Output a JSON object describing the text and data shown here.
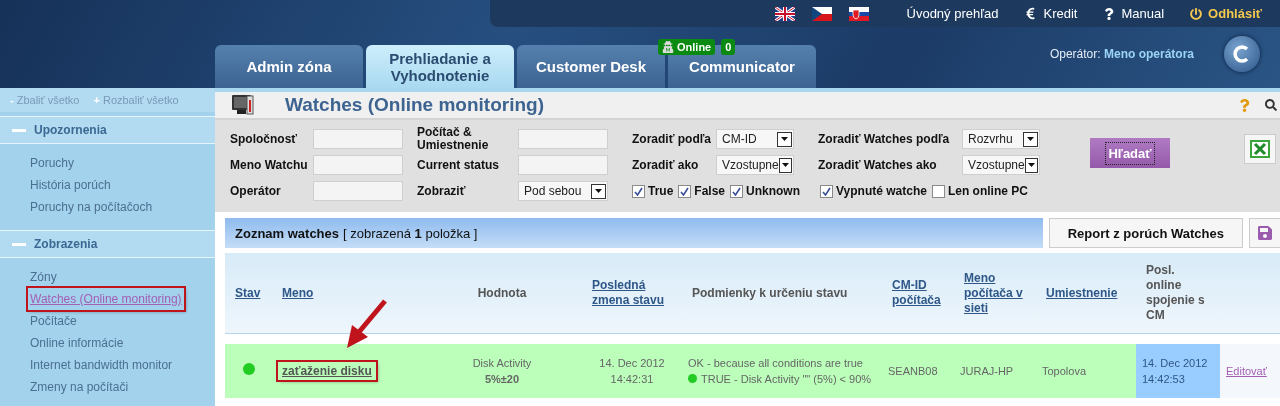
{
  "header": {
    "languages": [
      {
        "kind": "uk"
      },
      {
        "kind": "cz"
      },
      {
        "kind": "sk"
      }
    ],
    "top_links": [
      {
        "kind": "home",
        "label": "Úvodný prehľad"
      },
      {
        "kind": "credit",
        "label": "Kredit"
      },
      {
        "kind": "help",
        "label": "Manual"
      },
      {
        "kind": "logout",
        "label": "Odhlásiť"
      }
    ],
    "tabs": [
      {
        "label": "Admin zóna",
        "selected": false
      },
      {
        "label": "Prehliadanie a Vyhodnotenie",
        "selected": true
      },
      {
        "label": "Customer Desk",
        "selected": false
      },
      {
        "label": "Communicator",
        "selected": false,
        "badge": {
          "status": "Online",
          "count": "0"
        }
      }
    ],
    "operator": {
      "label": "Operátor:",
      "name": "Meno operátora"
    }
  },
  "sidebar": {
    "actions": [
      {
        "symbol": "-",
        "label": "Zbaliť všetko"
      },
      {
        "symbol": "+",
        "label": "Rozbaliť všetko"
      }
    ],
    "sections": [
      {
        "title": "Upozornenia",
        "expanded": true,
        "items": [
          {
            "label": "Poruchy",
            "selected": false,
            "annotated": false
          },
          {
            "label": "História porúch",
            "selected": false,
            "annotated": false
          },
          {
            "label": "Poruchy na počítačoch",
            "selected": false,
            "annotated": false
          }
        ]
      },
      {
        "title": "Zobrazenia",
        "expanded": true,
        "items": [
          {
            "label": "Zóny",
            "selected": false,
            "annotated": false
          },
          {
            "label": "Watches (Online monitoring)",
            "selected": true,
            "annotated": true
          },
          {
            "label": "Počítače",
            "selected": false,
            "annotated": false
          },
          {
            "label": "Online informácie",
            "selected": false,
            "annotated": false
          },
          {
            "label": "Internet bandwidth monitor",
            "selected": false,
            "annotated": false
          },
          {
            "label": "Zmeny na počítači",
            "selected": false,
            "annotated": false
          }
        ]
      }
    ]
  },
  "page": {
    "title": "Watches (Online monitoring)",
    "filter_rows": [
      [
        {
          "kind": "text",
          "label": "Spoločnosť"
        },
        {
          "kind": "text",
          "label": "Počítač & Umiestnenie"
        },
        {
          "kind": "select",
          "label": "Zoradiť podľa",
          "value": "CM-ID"
        },
        {
          "kind": "select",
          "label": "Zoradiť Watches podľa",
          "value": "Rozvrhu"
        }
      ],
      [
        {
          "kind": "text",
          "label": "Meno Watchu"
        },
        {
          "kind": "text",
          "label": "Current status"
        },
        {
          "kind": "select",
          "label": "Zoradiť ako",
          "value": "Vzostupne"
        },
        {
          "kind": "select",
          "label": "Zoradiť Watches ako",
          "value": "Vzostupne"
        }
      ],
      [
        {
          "kind": "text",
          "label": "Operátor"
        },
        {
          "kind": "select",
          "label": "Zobraziť",
          "value": "Pod sebou"
        }
      ]
    ],
    "checkboxes": [
      {
        "label": "True",
        "checked": true
      },
      {
        "label": "False",
        "checked": true
      },
      {
        "label": "Unknown",
        "checked": true
      },
      {
        "label": "Vypnuté watche",
        "checked": true
      },
      {
        "label": "Len online PC",
        "checked": false
      }
    ],
    "search_button": "Hľadať",
    "list": {
      "title": "Zoznam watches",
      "count": "[ zobrazená **1** položka ]",
      "report_button": "Report z porúch Watches"
    },
    "table": {
      "columns": [
        {
          "label": "Stav",
          "sortable": true
        },
        {
          "label": "Meno",
          "sortable": true
        },
        {
          "label": "Hodnota",
          "sortable": false
        },
        {
          "label": "Posledná zmena stavu",
          "sortable": true
        },
        {
          "label": "Podmienky k určeniu stavu",
          "sortable": false
        },
        {
          "label": "CM-ID počítača",
          "sortable": true
        },
        {
          "label": "Meno počítača v sieti",
          "sortable": true
        },
        {
          "label": "Umiestnenie",
          "sortable": true
        },
        {
          "label": "Posl. online spojenie s CM",
          "sortable": false
        }
      ],
      "rows": [
        {
          "status_dot": {
            "color": "#22cc22"
          },
          "name": "zaťaženie disku",
          "annotated": true,
          "value_label": "Disk Activity",
          "value": "5%±20",
          "last_change": "14. Dec 2012\n14:42:31",
          "condition_summary": "OK - because all conditions are true",
          "conditions": [
            {
              "color": "#22cc22",
              "text": "TRUE - Disk Activity \"\" (5%) < 90%"
            }
          ],
          "cm_id": "SEANB08",
          "computer": "JURAJ-HP",
          "location": "Topolova",
          "last_online": "14. Dec 2012\n14:42:53",
          "edit": "Editovať"
        }
      ]
    }
  }
}
